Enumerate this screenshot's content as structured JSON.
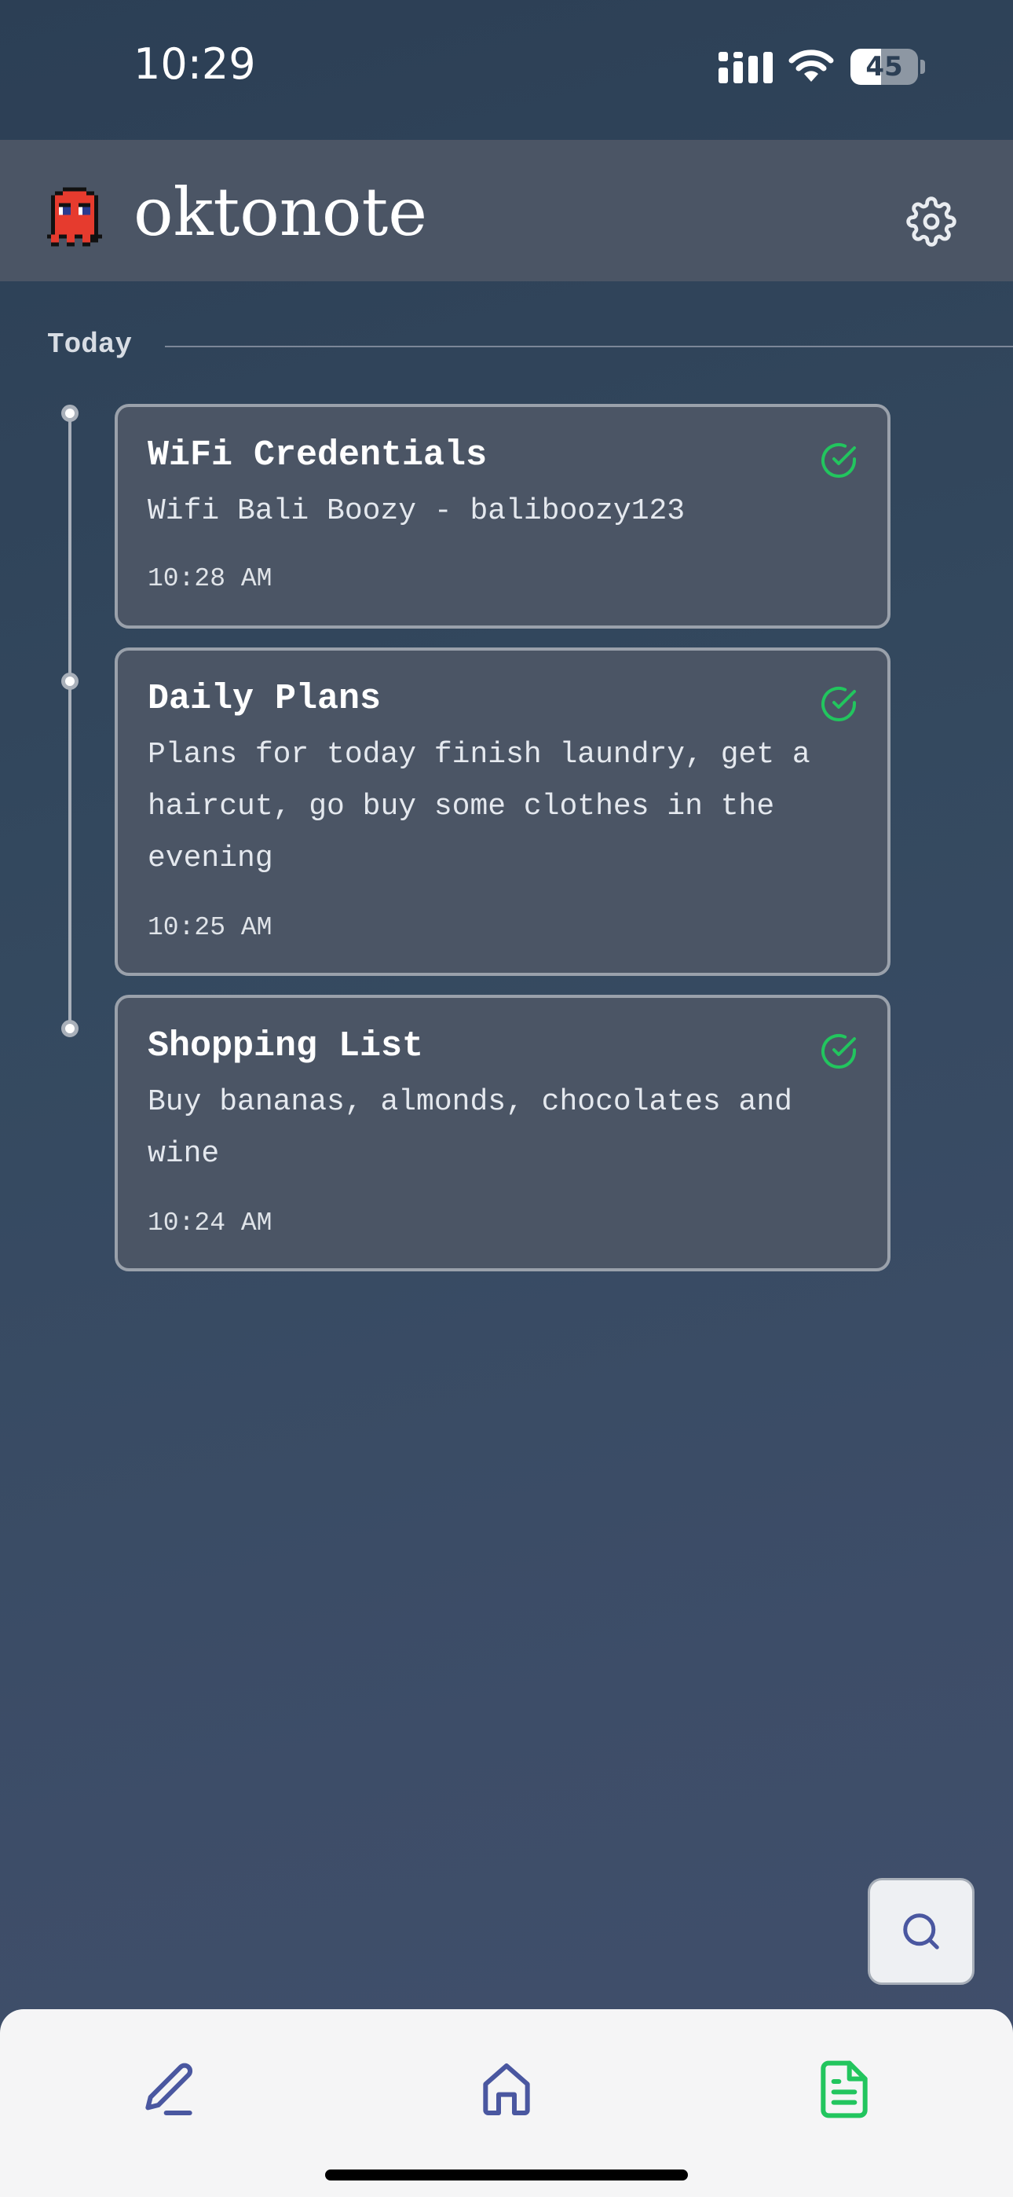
{
  "status_bar": {
    "time": "10:29",
    "battery_level": "45",
    "battery_fraction": 0.45
  },
  "header": {
    "title": "oktonote",
    "logo_icon": "red-ghost-logo-icon",
    "settings_icon": "gear-icon"
  },
  "section": {
    "label": "Today"
  },
  "notes": [
    {
      "title": "WiFi Credentials",
      "body": "Wifi Bali Boozy - baliboozy123",
      "time": "10:28 AM",
      "status_icon": "check-circle-icon"
    },
    {
      "title": "Daily Plans",
      "body": "Plans for today finish laundry, get a haircut, go buy some clothes in the evening",
      "time": "10:25 AM",
      "status_icon": "check-circle-icon"
    },
    {
      "title": "Shopping List",
      "body": "Buy bananas, almonds, chocolates and wine",
      "time": "10:24 AM",
      "status_icon": "check-circle-icon"
    }
  ],
  "bottom_nav": {
    "items": [
      {
        "icon": "pencil-icon",
        "active": false
      },
      {
        "icon": "home-icon",
        "active": false
      },
      {
        "icon": "document-icon",
        "active": true
      }
    ]
  },
  "colors": {
    "accent_green": "#22c55e",
    "nav_blue": "#4a57a0",
    "card_bg": "#4b5565"
  }
}
